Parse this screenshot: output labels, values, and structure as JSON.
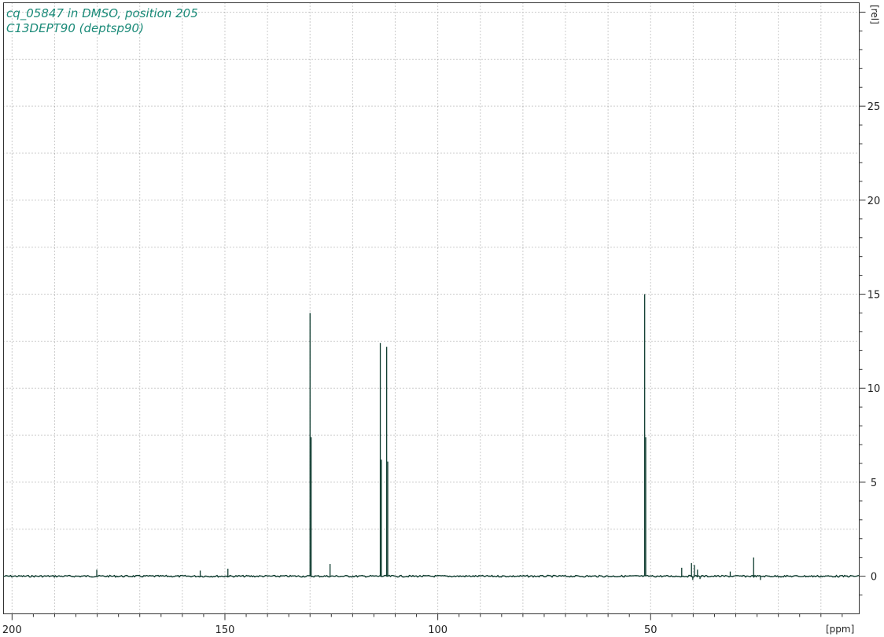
{
  "header": {
    "line1": "cq_05847 in DMSO, position 205",
    "line2": "C13DEPT90 (deptsp90)"
  },
  "colors": {
    "spectrum": "#0d3b2e",
    "title": "#1a8a78"
  },
  "chart_data": {
    "type": "line",
    "xlabel": "[ppm]",
    "ylabel": "[rel]",
    "xlim": [
      202,
      1
    ],
    "ylim": [
      -2,
      30.5
    ],
    "x_ticks": [
      200,
      150,
      100,
      50
    ],
    "y_ticks": [
      0,
      5,
      10,
      15,
      20,
      25
    ],
    "grid": true,
    "series": [
      {
        "peaks": [
          {
            "ppm": 180.1,
            "height": 0.35
          },
          {
            "ppm": 155.8,
            "height": 0.3
          },
          {
            "ppm": 149.3,
            "height": 0.4
          },
          {
            "ppm": 130.0,
            "height": 14.0
          },
          {
            "ppm": 129.75,
            "height": 7.4
          },
          {
            "ppm": 125.3,
            "height": 0.65
          },
          {
            "ppm": 113.5,
            "height": 12.4
          },
          {
            "ppm": 113.25,
            "height": 6.2
          },
          {
            "ppm": 112.0,
            "height": 12.2
          },
          {
            "ppm": 111.75,
            "height": 6.1
          },
          {
            "ppm": 51.4,
            "height": 15.0
          },
          {
            "ppm": 51.15,
            "height": 7.4
          },
          {
            "ppm": 42.7,
            "height": 0.45
          },
          {
            "ppm": 40.4,
            "height": 0.7
          },
          {
            "ppm": 40.1,
            "height": -0.2
          },
          {
            "ppm": 39.7,
            "height": 0.6
          },
          {
            "ppm": 39.0,
            "height": 0.35
          },
          {
            "ppm": 38.4,
            "height": -0.15
          },
          {
            "ppm": 31.3,
            "height": 0.25
          },
          {
            "ppm": 25.8,
            "height": 1.0
          },
          {
            "ppm": 24.2,
            "height": -0.2
          }
        ]
      }
    ]
  }
}
